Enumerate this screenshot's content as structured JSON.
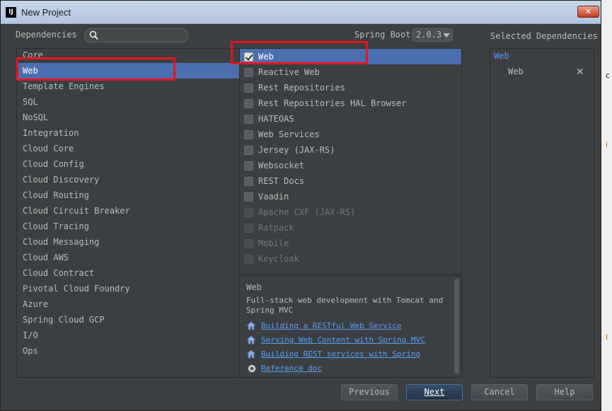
{
  "window": {
    "title": "New Project",
    "app_icon_text": "IJ",
    "close_symbol": "✕"
  },
  "header": {
    "dependencies_label": "Dependencies",
    "search_placeholder": "",
    "spring_boot_label": "Spring Boot",
    "spring_boot_version": "2.0.3",
    "selected_dependencies_label": "Selected Dependencies"
  },
  "categories": [
    {
      "label": "Core",
      "selected": false
    },
    {
      "label": "Web",
      "selected": true
    },
    {
      "label": "Template Engines",
      "selected": false
    },
    {
      "label": "SQL",
      "selected": false
    },
    {
      "label": "NoSQL",
      "selected": false
    },
    {
      "label": "Integration",
      "selected": false
    },
    {
      "label": "Cloud Core",
      "selected": false
    },
    {
      "label": "Cloud Config",
      "selected": false
    },
    {
      "label": "Cloud Discovery",
      "selected": false
    },
    {
      "label": "Cloud Routing",
      "selected": false
    },
    {
      "label": "Cloud Circuit Breaker",
      "selected": false
    },
    {
      "label": "Cloud Tracing",
      "selected": false
    },
    {
      "label": "Cloud Messaging",
      "selected": false
    },
    {
      "label": "Cloud AWS",
      "selected": false
    },
    {
      "label": "Cloud Contract",
      "selected": false
    },
    {
      "label": "Pivotal Cloud Foundry",
      "selected": false
    },
    {
      "label": "Azure",
      "selected": false
    },
    {
      "label": "Spring Cloud GCP",
      "selected": false
    },
    {
      "label": "I/O",
      "selected": false
    },
    {
      "label": "Ops",
      "selected": false
    }
  ],
  "dependencies": [
    {
      "label": "Web",
      "checked": true,
      "selected": true,
      "disabled": false
    },
    {
      "label": "Reactive Web",
      "checked": false,
      "selected": false,
      "disabled": false
    },
    {
      "label": "Rest Repositories",
      "checked": false,
      "selected": false,
      "disabled": false
    },
    {
      "label": "Rest Repositories HAL Browser",
      "checked": false,
      "selected": false,
      "disabled": false
    },
    {
      "label": "HATEOAS",
      "checked": false,
      "selected": false,
      "disabled": false
    },
    {
      "label": "Web Services",
      "checked": false,
      "selected": false,
      "disabled": false
    },
    {
      "label": "Jersey (JAX-RS)",
      "checked": false,
      "selected": false,
      "disabled": false
    },
    {
      "label": "Websocket",
      "checked": false,
      "selected": false,
      "disabled": false
    },
    {
      "label": "REST Docs",
      "checked": false,
      "selected": false,
      "disabled": false
    },
    {
      "label": "Vaadin",
      "checked": false,
      "selected": false,
      "disabled": false
    },
    {
      "label": "Apache CXF (JAX-RS)",
      "checked": false,
      "selected": false,
      "disabled": true
    },
    {
      "label": "Ratpack",
      "checked": false,
      "selected": false,
      "disabled": true
    },
    {
      "label": "Mobile",
      "checked": false,
      "selected": false,
      "disabled": true
    },
    {
      "label": "Keycloak",
      "checked": false,
      "selected": false,
      "disabled": true
    }
  ],
  "description": {
    "title": "Web",
    "text": "Full-stack web development with Tomcat and Spring MVC",
    "links": [
      {
        "label": "Building a RESTful Web Service",
        "icon": "home-icon"
      },
      {
        "label": "Serving Web Content with Spring MVC",
        "icon": "home-icon"
      },
      {
        "label": "Building REST services with Spring",
        "icon": "home-icon"
      },
      {
        "label": "Reference doc",
        "icon": "reference-doc-icon"
      }
    ]
  },
  "selected": {
    "group": "Web",
    "items": [
      {
        "label": "Web",
        "remove_symbol": "✕"
      }
    ]
  },
  "buttons": {
    "previous": "Previous",
    "next": "Next",
    "cancel": "Cancel",
    "help": "Help"
  },
  "colors": {
    "selection": "#4b6eaf",
    "link": "#589df6",
    "highlight_box": "#e8141d"
  }
}
